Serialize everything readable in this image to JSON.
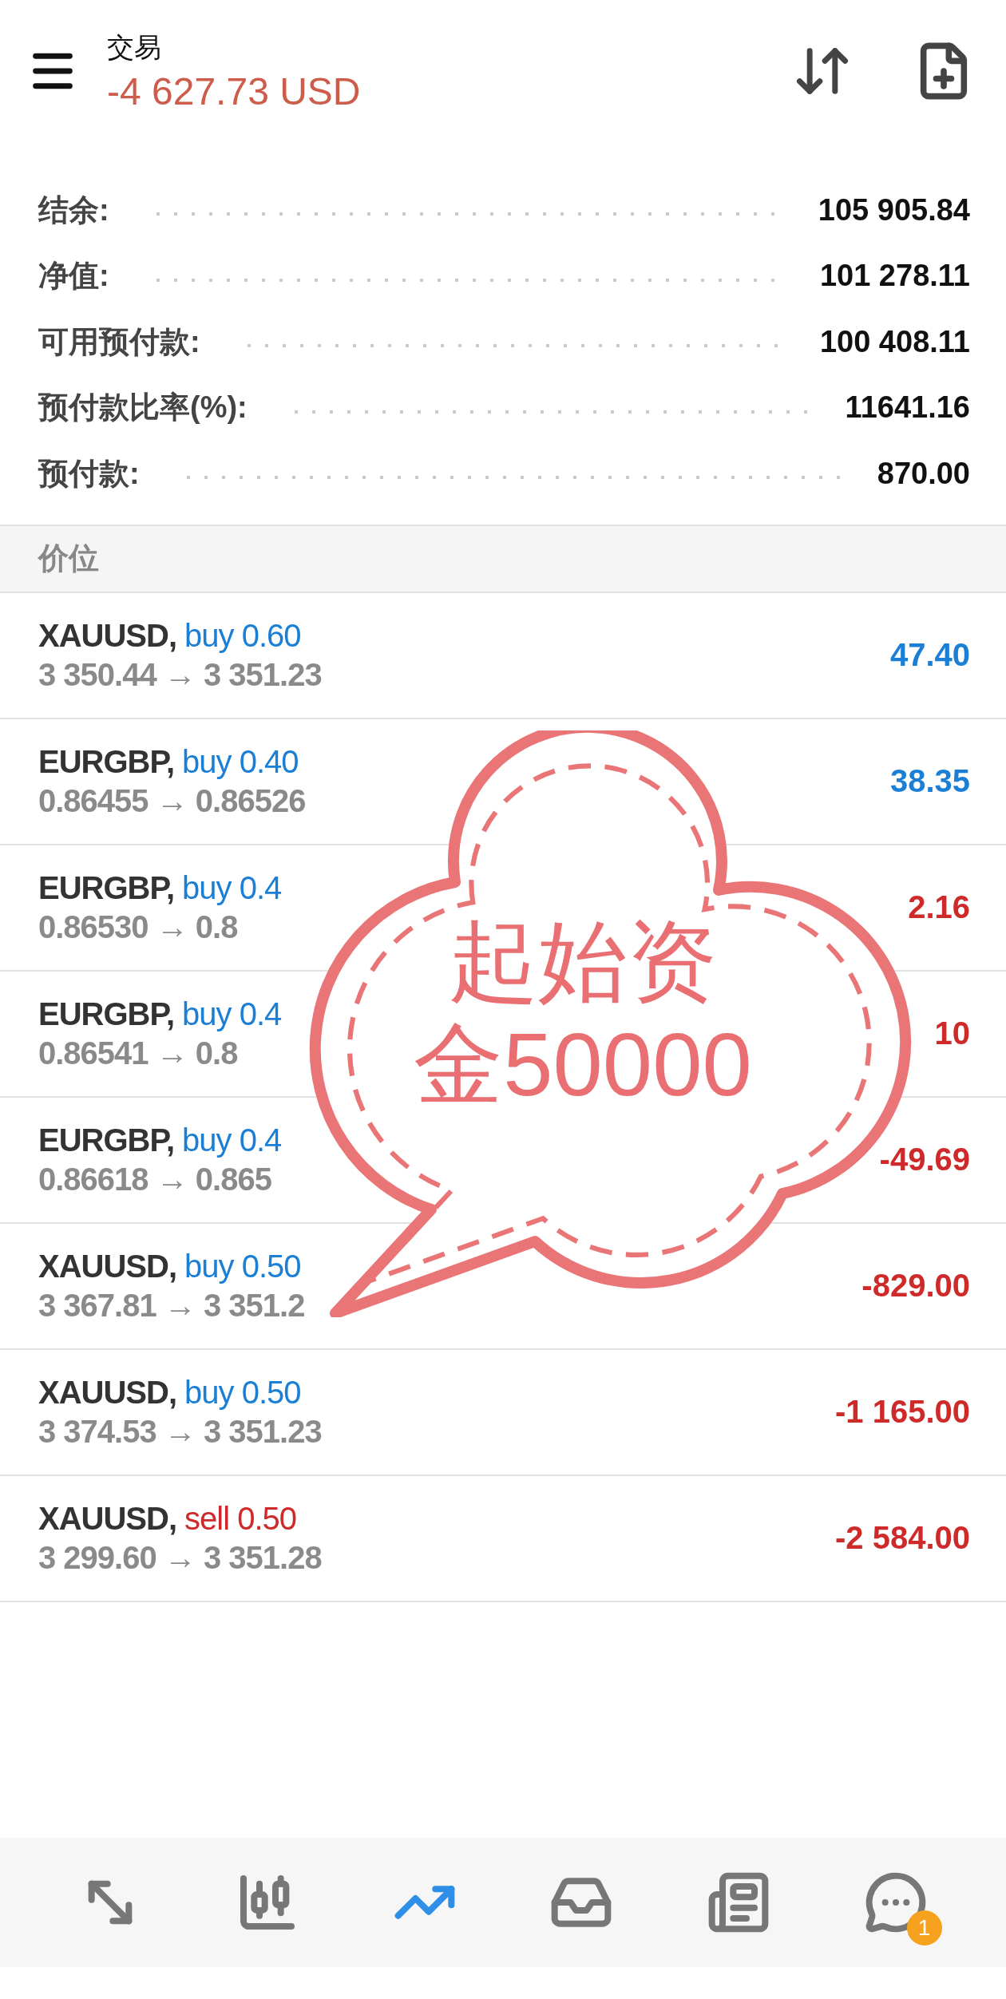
{
  "header": {
    "title": "交易",
    "balance": "-4 627.73 USD"
  },
  "summary": [
    {
      "label": "结余:",
      "value": "105 905.84"
    },
    {
      "label": "净值:",
      "value": "101 278.11"
    },
    {
      "label": "可用预付款:",
      "value": "100 408.11"
    },
    {
      "label": "预付款比率(%):",
      "value": "11641.16"
    },
    {
      "label": "预付款:",
      "value": "870.00"
    }
  ],
  "section": "价位",
  "positions": [
    {
      "symbol": "XAUUSD,",
      "side": "buy 0.60",
      "kind": "buy",
      "prices": "3 350.44 → 3 351.23",
      "profit": "47.40",
      "gain": true
    },
    {
      "symbol": "EURGBP,",
      "side": "buy 0.40",
      "kind": "buy",
      "prices": "0.86455 → 0.86526",
      "profit": "38.35",
      "gain": true
    },
    {
      "symbol": "EURGBP,",
      "side": "buy 0.4",
      "kind": "buy",
      "prices": "0.86530 → 0.8",
      "profit": "2.16",
      "gain": false
    },
    {
      "symbol": "EURGBP,",
      "side": "buy 0.4",
      "kind": "buy",
      "prices": "0.86541 → 0.8",
      "profit": "10",
      "gain": false
    },
    {
      "symbol": "EURGBP,",
      "side": "buy 0.4",
      "kind": "buy",
      "prices": "0.86618 → 0.865",
      "profit": "-49.69",
      "gain": false
    },
    {
      "symbol": "XAUUSD,",
      "side": "buy 0.50",
      "kind": "buy",
      "prices": "3 367.81 → 3 351.2",
      "profit": "-829.00",
      "gain": false
    },
    {
      "symbol": "XAUUSD,",
      "side": "buy 0.50",
      "kind": "buy",
      "prices": "3 374.53 → 3 351.23",
      "profit": "-1 165.00",
      "gain": false
    },
    {
      "symbol": "XAUUSD,",
      "side": "sell 0.50",
      "kind": "sell",
      "prices": "3 299.60 → 3 351.28",
      "profit": "-2 584.00",
      "gain": false
    }
  ],
  "sticker": {
    "lines": [
      "起始资",
      "金50000"
    ]
  },
  "nav": [
    {
      "kind": "trade",
      "selected": false
    },
    {
      "kind": "chart",
      "selected": false
    },
    {
      "kind": "trend",
      "selected": true
    },
    {
      "kind": "inbox",
      "selected": false
    },
    {
      "kind": "news",
      "selected": false
    },
    {
      "kind": "chat",
      "selected": false,
      "badge": "1"
    }
  ]
}
